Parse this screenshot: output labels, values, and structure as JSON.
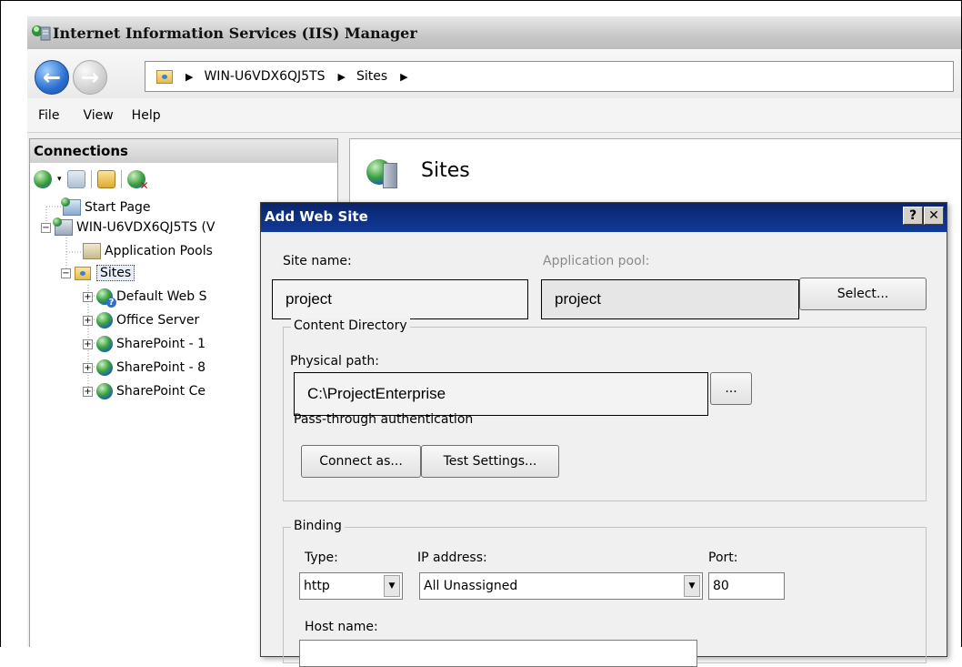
{
  "window": {
    "title": "Internet Information Services (IIS) Manager"
  },
  "address": {
    "crumbs": [
      "WIN-U6VDX6QJ5TS",
      "Sites"
    ]
  },
  "menu": {
    "file": "File",
    "view": "View",
    "help": "Help"
  },
  "connections": {
    "header": "Connections",
    "tree": {
      "start_page": "Start Page",
      "server": "WIN-U6VDX6QJ5TS (V",
      "app_pools": "Application Pools",
      "sites": "Sites",
      "site_items": [
        "Default Web S",
        "Office Server",
        "SharePoint - 1",
        "SharePoint - 8",
        "SharePoint Ce"
      ]
    }
  },
  "content": {
    "title": "Sites"
  },
  "dialog": {
    "title": "Add Web Site",
    "help_label": "?",
    "close_label": "✕",
    "site_name_label": "Site name:",
    "site_name_value": "project",
    "app_pool_label": "Application pool:",
    "app_pool_value": "project",
    "select_button": "Select...",
    "content_group": "Content Directory",
    "physical_path_label": "Physical path:",
    "physical_path_value": "C:\\ProjectEnterprise",
    "browse_button": "...",
    "pass_through_label": "Pass-through authentication",
    "connect_as_button": "Connect as...",
    "test_settings_button": "Test Settings...",
    "binding_group": "Binding",
    "type_label": "Type:",
    "type_value": "http",
    "ip_label": "IP address:",
    "ip_value": "All Unassigned",
    "port_label": "Port:",
    "port_value": "80",
    "host_label": "Host name:"
  }
}
